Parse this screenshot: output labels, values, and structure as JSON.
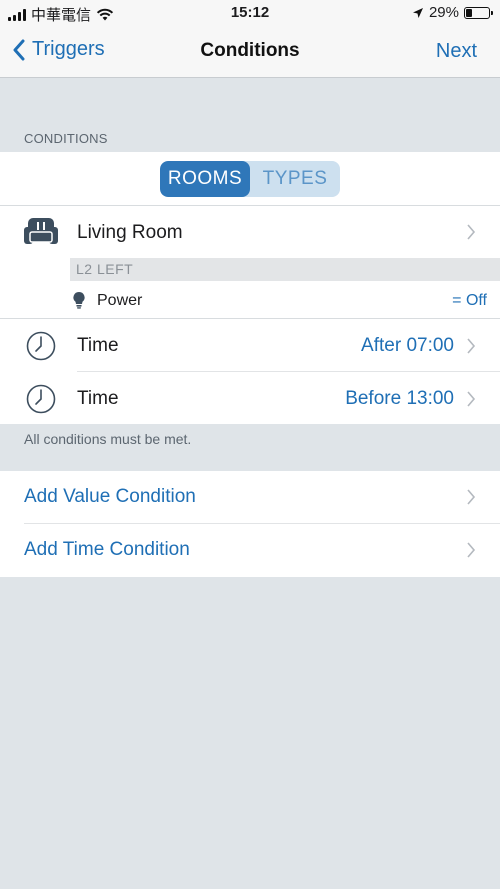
{
  "status_bar": {
    "carrier": "中華電信",
    "time": "15:12",
    "battery": "29%",
    "battery_level": 0.29,
    "icons": [
      "signal-icon",
      "wifi-icon",
      "location-arrow-icon",
      "battery-icon"
    ]
  },
  "nav": {
    "back_label": "Triggers",
    "title": "Conditions",
    "next_label": "Next"
  },
  "section_label": "CONDITIONS",
  "segmented": {
    "options": [
      "ROOMS",
      "TYPES"
    ],
    "selected": "ROOMS"
  },
  "room": {
    "icon": "sofa-icon",
    "name": "Living Room",
    "group": "L2 LEFT",
    "device": {
      "icon": "lightbulb-icon",
      "label": "Power",
      "value": "= Off"
    }
  },
  "time_conditions": [
    {
      "icon": "clock-icon",
      "label": "Time",
      "value": "After 07:00"
    },
    {
      "icon": "clock-icon",
      "label": "Time",
      "value": "Before 13:00"
    }
  ],
  "footer_note": "All conditions must be met.",
  "actions": [
    {
      "label": "Add Value Condition"
    },
    {
      "label": "Add Time Condition"
    }
  ],
  "colors": {
    "accent": "#1f6fb5",
    "segment_active": "#2f77b9",
    "segment_inactive_bg": "#cde0ef",
    "background": "#dfe4e8"
  }
}
